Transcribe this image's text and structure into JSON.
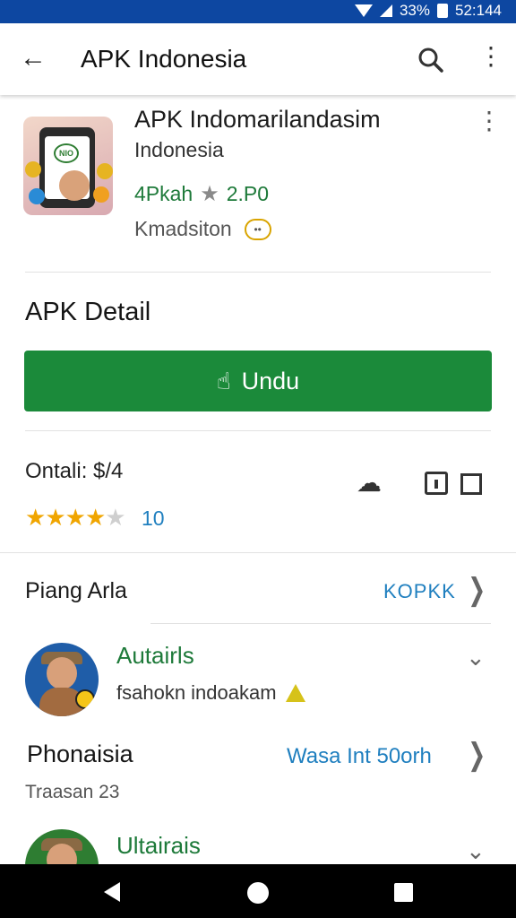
{
  "status_bar": {
    "battery_text": "33%",
    "time": "52:144"
  },
  "app_bar": {
    "title": "APK Indonesia",
    "back_icon": "arrow-left-icon",
    "search_icon": "search-icon",
    "more_icon": "more-vert-icon"
  },
  "app_card": {
    "name": "APK Indomarilandasim",
    "developer": "Indonesia",
    "rating_text": "4Pkah",
    "rating_value": "2.P0",
    "category": "Kmadsiton",
    "icon_badge": "NIO"
  },
  "detail": {
    "section_title": "APK Detail",
    "install_label": "Undu",
    "meta_label": "Ontali: $/4",
    "stars_filled": 4,
    "stars_total": 5,
    "rating_count": "10"
  },
  "row1": {
    "title": "Piang Arla",
    "link": "KOPKK"
  },
  "review1": {
    "name": "Autairls",
    "text": "fsahokn indoakam"
  },
  "row2": {
    "title": "Phonaisia",
    "subtitle": "Traasan 23",
    "link": "Wasa Int 50orh"
  },
  "review2": {
    "name": "Ultairais"
  },
  "colors": {
    "status_bar": "#0d47a1",
    "install_button": "#1b8a3a",
    "link": "#1f7fbf",
    "reviewer": "#1e7a3a",
    "star": "#f0a500"
  }
}
